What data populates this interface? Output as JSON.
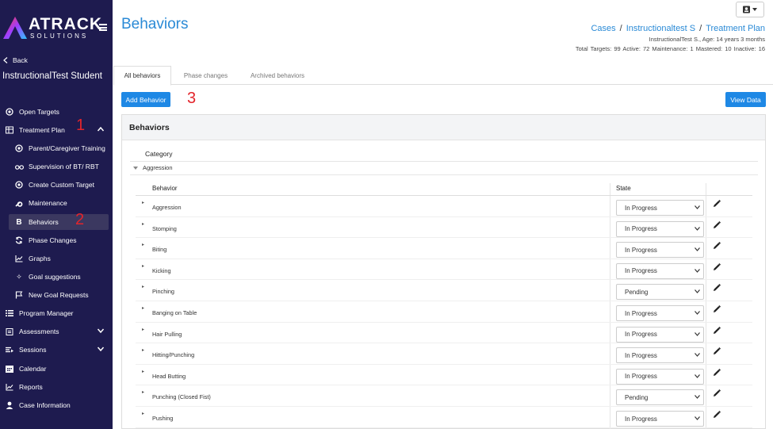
{
  "brand": {
    "name": "ATRACK",
    "tagline": "SOLUTIONS"
  },
  "sidebar": {
    "back_label": "Back",
    "student_name": "InstructionalTest Student",
    "items": [
      {
        "label": "Open Targets",
        "icon": "target-icon"
      },
      {
        "label": "Treatment Plan",
        "icon": "table-icon",
        "expanded": true
      },
      {
        "label": "Parent/Caregiver Training",
        "icon": "target-icon"
      },
      {
        "label": "Supervision of BT/ RBT",
        "icon": "glasses-icon"
      },
      {
        "label": "Create Custom Target",
        "icon": "target-icon"
      },
      {
        "label": "Maintenance",
        "icon": "wrench-icon"
      },
      {
        "label": "Behaviors",
        "icon": "bold-b-icon",
        "active": true
      },
      {
        "label": "Phase Changes",
        "icon": "sync-icon"
      },
      {
        "label": "Graphs",
        "icon": "line-chart-icon"
      },
      {
        "label": "Goal suggestions",
        "icon": "sparkle-icon"
      },
      {
        "label": "New Goal Requests",
        "icon": "flag-icon"
      },
      {
        "label": "Program Manager",
        "icon": "list-icon"
      },
      {
        "label": "Assessments",
        "icon": "clipboard-icon"
      },
      {
        "label": "Sessions",
        "icon": "sessions-icon"
      },
      {
        "label": "Calendar",
        "icon": "calendar-icon"
      },
      {
        "label": "Reports",
        "icon": "line-chart-icon"
      },
      {
        "label": "Case Information",
        "icon": "user-icon"
      }
    ]
  },
  "annotations": {
    "one": "1",
    "two": "2",
    "three": "3"
  },
  "header": {
    "title": "Behaviors",
    "breadcrumb": [
      "Cases",
      "Instructionaltest S",
      "Treatment Plan"
    ],
    "patient_info": "InstructionalTest S., Age: 14 years 3 months",
    "stats": "Total Targets: 99  Active: 72  Maintenance: 1  Mastered: 10  Inactive: 16"
  },
  "tabs": [
    "All behaviors",
    "Phase changes",
    "Archived behaviors"
  ],
  "actions": {
    "add": "Add Behavior",
    "view": "View Data"
  },
  "panel": {
    "title": "Behaviors",
    "category_header": "Category",
    "category": "Aggression",
    "col_behavior": "Behavior",
    "col_state": "State",
    "rows": [
      {
        "name": "Aggression",
        "state": "In Progress"
      },
      {
        "name": "Stomping",
        "state": "In Progress"
      },
      {
        "name": "Biting",
        "state": "In Progress"
      },
      {
        "name": "Kicking",
        "state": "In Progress"
      },
      {
        "name": "Pinching",
        "state": "Pending"
      },
      {
        "name": "Banging on Table",
        "state": "In Progress"
      },
      {
        "name": "Hair Pulling",
        "state": "In Progress"
      },
      {
        "name": "Hitting/Punching",
        "state": "In Progress"
      },
      {
        "name": "Head Butting",
        "state": "In Progress"
      },
      {
        "name": "Punching (Closed Fist)",
        "state": "Pending"
      },
      {
        "name": "Pushing",
        "state": "In Progress"
      }
    ]
  },
  "colors": {
    "sidebar": "#1e1b4f",
    "accent": "#1e88e5",
    "annotation": "#e3242b"
  }
}
